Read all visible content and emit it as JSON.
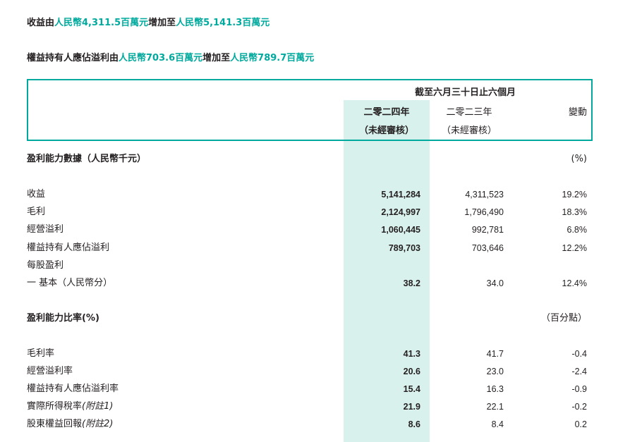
{
  "headlines": {
    "line1": {
      "p1": "收益由",
      "v1": "人民幣4,311.5百萬元",
      "p2": "增加至",
      "v2": "人民幣5,141.3百萬元"
    },
    "line2": {
      "p1": "權益持有人應佔溢利由",
      "v1": "人民幣703.6百萬元",
      "p2": "增加至",
      "v2": "人民幣789.7百萬元"
    }
  },
  "table": {
    "period": "截至六月三十日止六個月",
    "col_2024": {
      "line1": "二零二四年",
      "line2": "（未經審核）"
    },
    "col_2023": {
      "line1": "二零二三年",
      "line2": "（未經審核）"
    },
    "col_change": "變動",
    "section1": {
      "title": "盈利能力數據（人民幣千元）",
      "unit": "(%)",
      "rows": [
        {
          "label": "收益",
          "v2024": "5,141,284",
          "v2023": "4,311,523",
          "change": "19.2%"
        },
        {
          "label": "毛利",
          "v2024": "2,124,997",
          "v2023": "1,796,490",
          "change": "18.3%"
        },
        {
          "label": "經營溢利",
          "v2024": "1,060,445",
          "v2023": "992,781",
          "change": "6.8%"
        },
        {
          "label": "權益持有人應佔溢利",
          "v2024": "789,703",
          "v2023": "703,646",
          "change": "12.2%"
        },
        {
          "label": "每股盈利"
        },
        {
          "label": "一 基本（人民幣分）",
          "v2024": "38.2",
          "v2023": "34.0",
          "change": "12.4%"
        }
      ]
    },
    "section2": {
      "title": "盈利能力比率(%)",
      "unit": "（百分點）",
      "rows": [
        {
          "label": "毛利率",
          "v2024": "41.3",
          "v2023": "41.7",
          "change": "-0.4"
        },
        {
          "label": "經營溢利率",
          "v2024": "20.6",
          "v2023": "23.0",
          "change": "-2.4"
        },
        {
          "label": "權益持有人應佔溢利率",
          "v2024": "15.4",
          "v2023": "16.3",
          "change": "-0.9"
        },
        {
          "label": "實際所得稅率",
          "note": "(附註1)",
          "v2024": "21.9",
          "v2023": "22.1",
          "change": "-0.2"
        },
        {
          "label": "股東權益回報",
          "note": "(附註2)",
          "v2024": "8.6",
          "v2023": "8.4",
          "change": "0.2"
        }
      ]
    }
  },
  "colors": {
    "accent": "#00a99d",
    "highlight": "#d9f1ec",
    "text": "#231f20"
  }
}
